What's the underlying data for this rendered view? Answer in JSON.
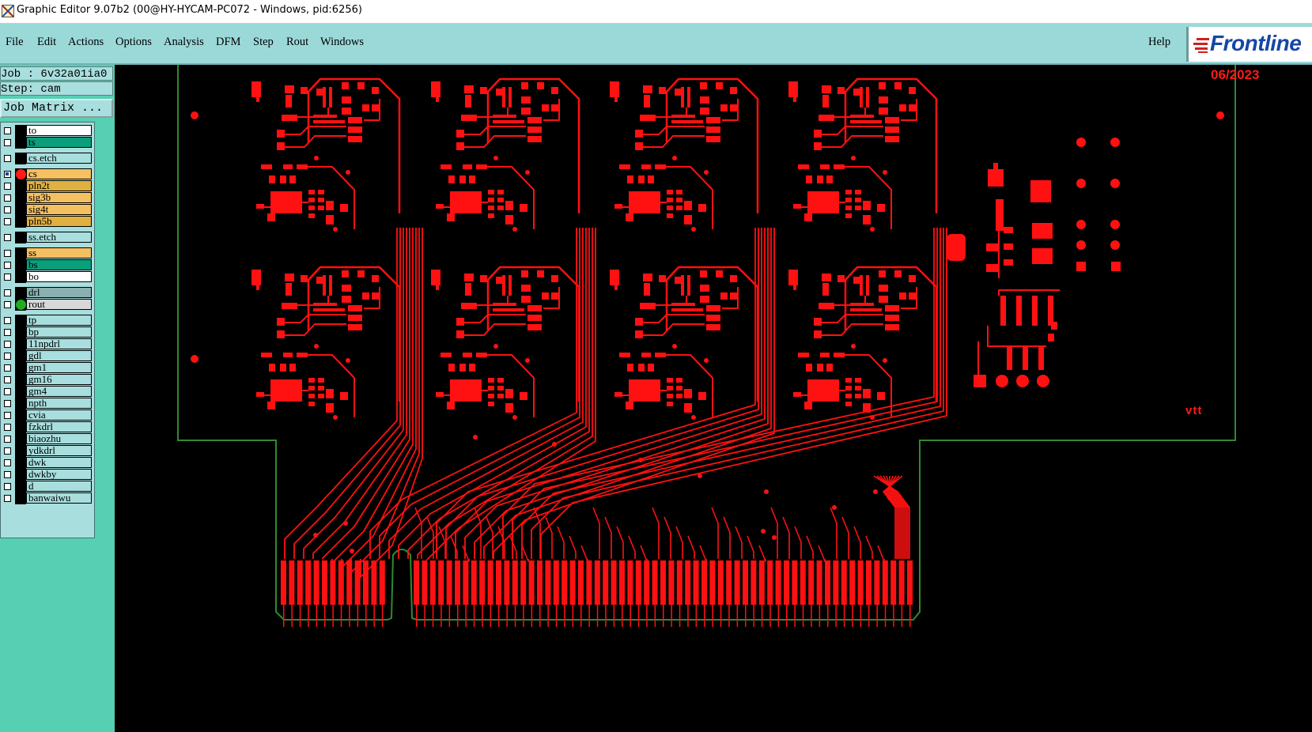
{
  "window": {
    "title": "Graphic Editor 9.07b2 (00@HY-HYCAM-PC072 - Windows, pid:6256)"
  },
  "menu": {
    "items": [
      "File",
      "Edit",
      "Actions",
      "Options",
      "Analysis",
      "DFM",
      "Step",
      "Rout",
      "Windows"
    ],
    "help": "Help"
  },
  "logo": {
    "text": "Frontline"
  },
  "job": {
    "job_label": "Job :",
    "job_name": "6v32a01ia0",
    "step_label": "Step:",
    "step_name": "cam",
    "matrix_button": "Job Matrix ..."
  },
  "layers": [
    {
      "name": "to",
      "color": "#ffffff"
    },
    {
      "name": "ts",
      "color": "#0a9e7a"
    },
    {
      "name": "cs.etch",
      "color": "#a8dede"
    },
    {
      "name": "cs",
      "color": "#f5c060",
      "selected": true,
      "active": true
    },
    {
      "name": "pln2t",
      "color": "#e0b040"
    },
    {
      "name": "sig3b",
      "color": "#f5c060"
    },
    {
      "name": "sig4t",
      "color": "#f5c060"
    },
    {
      "name": "pln5b",
      "color": "#e0b040"
    },
    {
      "name": "ss.etch",
      "color": "#a8dede"
    },
    {
      "name": "ss",
      "color": "#f5c060"
    },
    {
      "name": "bs",
      "color": "#0a9e7a"
    },
    {
      "name": "bo",
      "color": "#ffffff"
    },
    {
      "name": "drl",
      "color": "#8ab0b0"
    },
    {
      "name": "rout",
      "color": "#d8d8d8",
      "marker": "green"
    },
    {
      "name": "tp",
      "color": "#a8dede"
    },
    {
      "name": "bp",
      "color": "#a8dede"
    },
    {
      "name": "11npdrl",
      "color": "#a8dede"
    },
    {
      "name": "gdl",
      "color": "#a8dede"
    },
    {
      "name": "gm1",
      "color": "#a8dede"
    },
    {
      "name": "gm16",
      "color": "#a8dede"
    },
    {
      "name": "gm4",
      "color": "#a8dede"
    },
    {
      "name": "npth",
      "color": "#a8dede"
    },
    {
      "name": "cvia",
      "color": "#a8dede"
    },
    {
      "name": "fzkdrl",
      "color": "#a8dede"
    },
    {
      "name": "biaozhu",
      "color": "#a8dede"
    },
    {
      "name": "ydkdrl",
      "color": "#a8dede"
    },
    {
      "name": "dwk",
      "color": "#a8dede"
    },
    {
      "name": "dwkby",
      "color": "#a8dede"
    },
    {
      "name": "d",
      "color": "#a8dede"
    },
    {
      "name": "banwaiwu",
      "color": "#a8dede"
    }
  ],
  "canvas": {
    "date_text": "06/2023",
    "marker_text": "vtt",
    "copper_color": "#ff1111",
    "outline_color": "#2f8a2f"
  }
}
